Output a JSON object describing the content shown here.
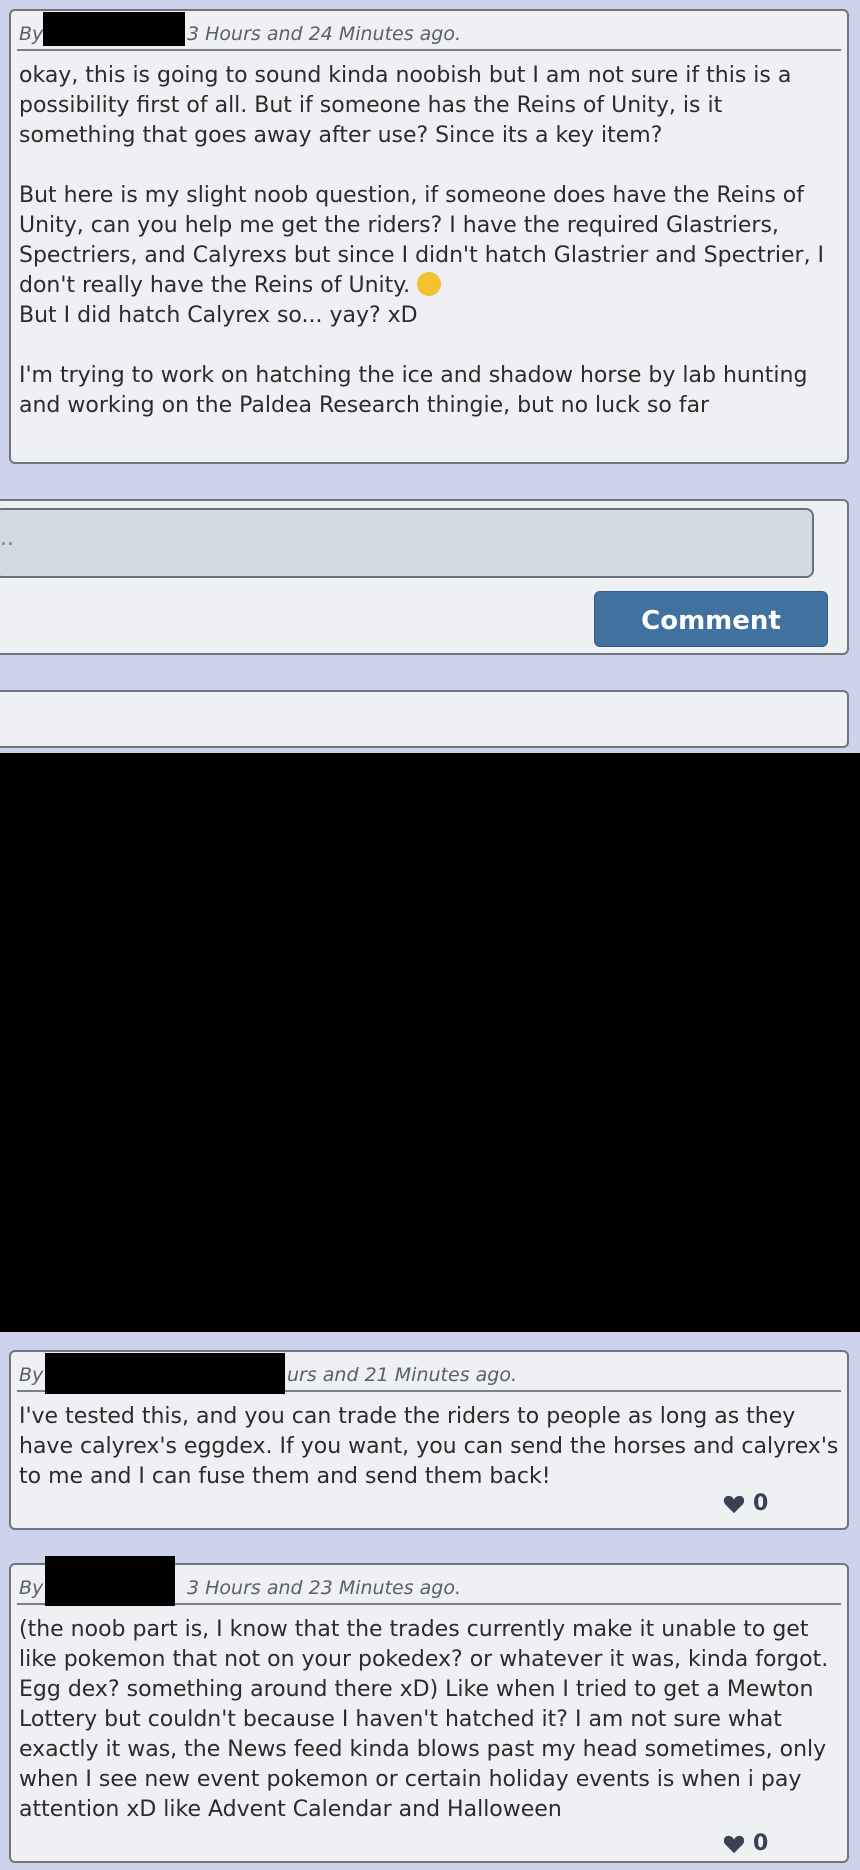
{
  "post1": {
    "by_label": "By",
    "time_fragment": "3 Hours and 24 Minutes ago.",
    "paragraphs": [
      "okay, this is going to sound kinda noobish but I am not sure if this is a possibility first of all. But if someone has the Reins of Unity, is it something that goes away after use? Since its a key item?",
      "But here is my slight noob question, if someone does have the Reins of Unity, can you help me get the riders? I have the required Glastriers, Spectriers, and Calyrexs but since I didn't hatch Glastrier and Spectrier, I don't really have the Reins of Unity.",
      "But I did hatch Calyrex so... yay? xD",
      "I'm trying to work on hatching the ice and shadow horse by lab hunting and working on the Paldea Research thingie, but no luck so far"
    ],
    "emoji": "grinning-sweat-emoji"
  },
  "reply_box": {
    "placeholder": "..",
    "button_label": "Comment"
  },
  "post2": {
    "by_label": "By",
    "time_fragment": "urs and 21 Minutes ago.",
    "text": "I've tested this, and you can trade the riders to people as long as they have calyrex's eggdex. If you want, you can send the horses and calyrex's to me and I can fuse them and send them back!",
    "likes": "0"
  },
  "post3": {
    "by_label": "By",
    "time_fragment": "3 Hours and 23 Minutes ago.",
    "text": "(the noob part is, I know that the trades currently make it unable to get like pokemon that not on your pokedex? or whatever it was, kinda forgot. Egg dex? something around there xD) Like when I tried to get a Mewton Lottery but couldn't because I haven't hatched it? I am not sure what exactly it was, the News feed kinda blows past my head sometimes, only when I see new event pokemon or certain holiday events is when i pay attention xD like Advent Calendar and Halloween",
    "likes": "0"
  },
  "colors": {
    "background": "#cdd3ea",
    "card": "#eef0f3",
    "button": "#40719f"
  }
}
